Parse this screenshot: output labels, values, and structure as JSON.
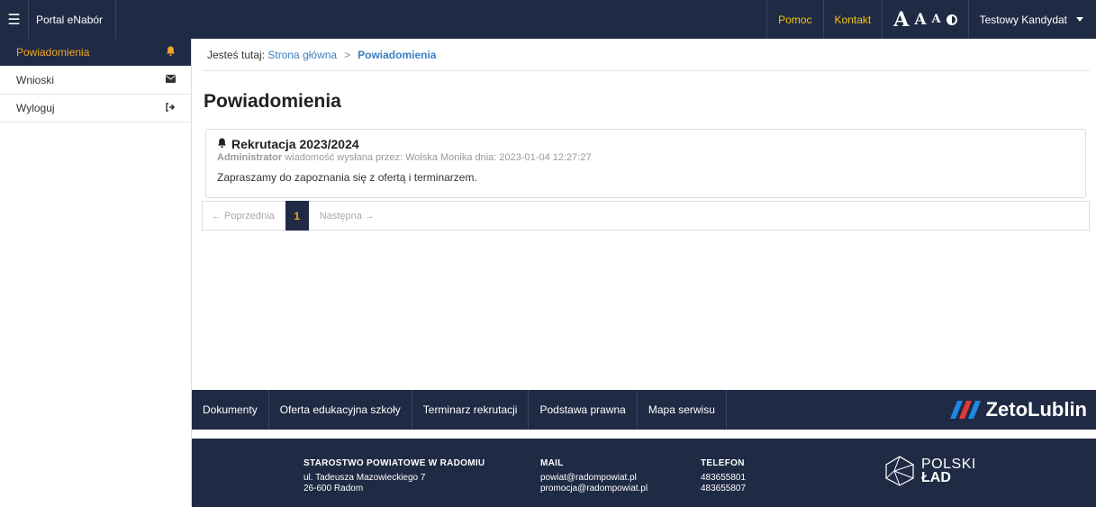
{
  "topbar": {
    "brand": "Portal eNabór",
    "help": "Pomoc",
    "contact": "Kontakt",
    "font_big": "A",
    "font_medium": "A",
    "font_small": "A",
    "user": "Testowy Kandydat"
  },
  "sidebar": {
    "items": [
      {
        "label": "Powiadomienia",
        "icon": "bell-icon"
      },
      {
        "label": "Wnioski",
        "icon": "envelope-icon"
      },
      {
        "label": "Wyloguj",
        "icon": "sign-out-icon"
      }
    ]
  },
  "breadcrumb": {
    "prefix": "Jesteś tutaj:",
    "home": "Strona główna",
    "current": "Powiadomienia"
  },
  "page_title": "Powiadomienia",
  "notification": {
    "title": "Rekrutacja 2023/2024",
    "author_role": "Administrator",
    "meta": "wiadomość wysłana przez: Wolska Monika dnia: 2023-01-04 12:27:27",
    "body": "Zapraszamy do zapoznania się z ofertą i terminarzem."
  },
  "pager": {
    "prev": "← Poprzednia",
    "current": "1",
    "next": "Następna →"
  },
  "footer_nav": {
    "items": [
      "Dokumenty",
      "Oferta edukacyjna szkoły",
      "Terminarz rekrutacji",
      "Podstawa prawna",
      "Mapa serwisu"
    ],
    "logo_text": "ZetoLublin"
  },
  "footer_info": {
    "org_name": "STAROSTWO POWIATOWE W RADOMIU",
    "org_addr1": "ul. Tadeusza Mazowieckiego 7",
    "org_addr2": "26-600 Radom",
    "mail_head": "MAIL",
    "mail1": "powiat@radompowiat.pl",
    "mail2": "promocja@radompowiat.pl",
    "phone_head": "TELEFON",
    "phone1": "483655801",
    "phone2": "483655807",
    "logo_top": "POLSKI",
    "logo_bottom": "ŁAD"
  },
  "colors": {
    "navy": "#1f2a44",
    "accent_yellow": "#f5c518",
    "accent_orange": "#f5a623",
    "link_blue": "#3a7fc1",
    "zeto_blue": "#1e88e5",
    "zeto_red": "#e53935"
  }
}
